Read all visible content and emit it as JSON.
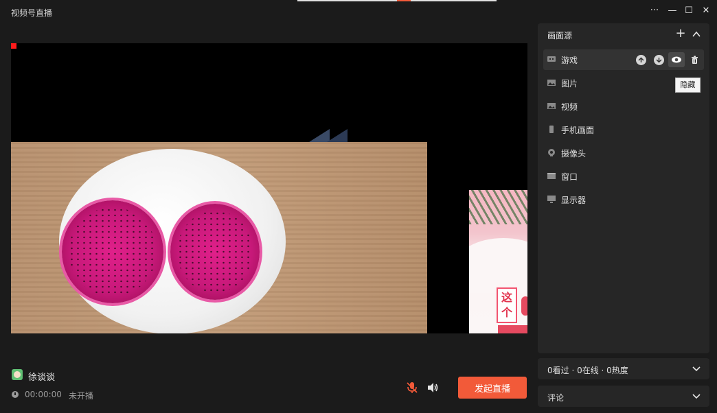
{
  "window": {
    "title": "视频号直播",
    "controls": {
      "more": "···",
      "minimize": "—",
      "maximize": "☐",
      "close": "✕"
    }
  },
  "preview": {
    "sources_shown": [
      "游戏",
      "图片",
      "视频"
    ],
    "poster_text": "这个"
  },
  "streamer": {
    "name": "徐谈谈"
  },
  "status": {
    "timer": "00:00:00",
    "live_state": "未开播"
  },
  "controls": {
    "mic_icon": "mic-muted-icon",
    "speaker_icon": "speaker-icon",
    "start_label": "发起直播"
  },
  "source_panel": {
    "title": "画面源",
    "add_icon": "+",
    "collapse_icon": "chevron-up-icon",
    "items": [
      {
        "label": "游戏",
        "icon": "game-icon",
        "active": true
      },
      {
        "label": "图片",
        "icon": "image-icon"
      },
      {
        "label": "视频",
        "icon": "video-icon"
      },
      {
        "label": "手机画面",
        "icon": "phone-icon"
      },
      {
        "label": "摄像头",
        "icon": "camera-icon"
      },
      {
        "label": "窗口",
        "icon": "window-icon"
      },
      {
        "label": "显示器",
        "icon": "monitor-icon"
      }
    ],
    "item_actions": [
      "move-up-icon",
      "move-down-icon",
      "eye-icon",
      "trash-icon"
    ],
    "tooltip": "隐藏"
  },
  "stats": {
    "label": "0看过 · 0在线 · 0热度"
  },
  "comments": {
    "label": "评论"
  },
  "colors": {
    "accent": "#f25a39",
    "background": "#1b1b1b",
    "panel": "#262626"
  }
}
